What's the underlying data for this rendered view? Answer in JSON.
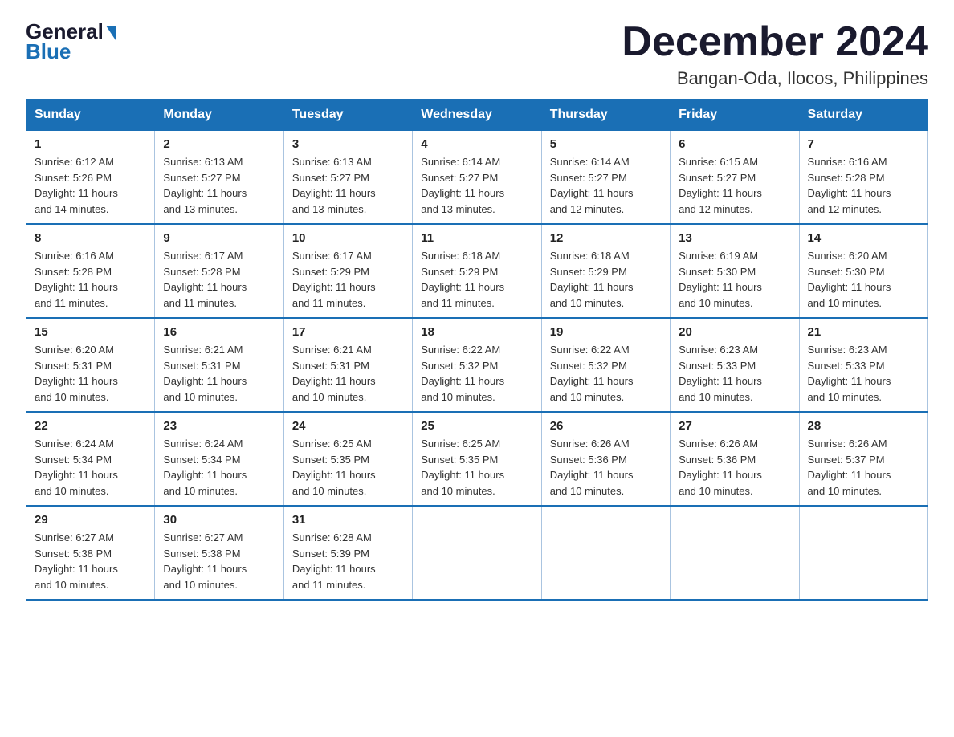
{
  "header": {
    "logo_general": "General",
    "logo_blue": "Blue",
    "month_title": "December 2024",
    "location": "Bangan-Oda, Ilocos, Philippines"
  },
  "days_of_week": [
    "Sunday",
    "Monday",
    "Tuesday",
    "Wednesday",
    "Thursday",
    "Friday",
    "Saturday"
  ],
  "weeks": [
    [
      {
        "day": "1",
        "sunrise": "6:12 AM",
        "sunset": "5:26 PM",
        "daylight": "11 hours and 14 minutes."
      },
      {
        "day": "2",
        "sunrise": "6:13 AM",
        "sunset": "5:27 PM",
        "daylight": "11 hours and 13 minutes."
      },
      {
        "day": "3",
        "sunrise": "6:13 AM",
        "sunset": "5:27 PM",
        "daylight": "11 hours and 13 minutes."
      },
      {
        "day": "4",
        "sunrise": "6:14 AM",
        "sunset": "5:27 PM",
        "daylight": "11 hours and 13 minutes."
      },
      {
        "day": "5",
        "sunrise": "6:14 AM",
        "sunset": "5:27 PM",
        "daylight": "11 hours and 12 minutes."
      },
      {
        "day": "6",
        "sunrise": "6:15 AM",
        "sunset": "5:27 PM",
        "daylight": "11 hours and 12 minutes."
      },
      {
        "day": "7",
        "sunrise": "6:16 AM",
        "sunset": "5:28 PM",
        "daylight": "11 hours and 12 minutes."
      }
    ],
    [
      {
        "day": "8",
        "sunrise": "6:16 AM",
        "sunset": "5:28 PM",
        "daylight": "11 hours and 11 minutes."
      },
      {
        "day": "9",
        "sunrise": "6:17 AM",
        "sunset": "5:28 PM",
        "daylight": "11 hours and 11 minutes."
      },
      {
        "day": "10",
        "sunrise": "6:17 AM",
        "sunset": "5:29 PM",
        "daylight": "11 hours and 11 minutes."
      },
      {
        "day": "11",
        "sunrise": "6:18 AM",
        "sunset": "5:29 PM",
        "daylight": "11 hours and 11 minutes."
      },
      {
        "day": "12",
        "sunrise": "6:18 AM",
        "sunset": "5:29 PM",
        "daylight": "11 hours and 10 minutes."
      },
      {
        "day": "13",
        "sunrise": "6:19 AM",
        "sunset": "5:30 PM",
        "daylight": "11 hours and 10 minutes."
      },
      {
        "day": "14",
        "sunrise": "6:20 AM",
        "sunset": "5:30 PM",
        "daylight": "11 hours and 10 minutes."
      }
    ],
    [
      {
        "day": "15",
        "sunrise": "6:20 AM",
        "sunset": "5:31 PM",
        "daylight": "11 hours and 10 minutes."
      },
      {
        "day": "16",
        "sunrise": "6:21 AM",
        "sunset": "5:31 PM",
        "daylight": "11 hours and 10 minutes."
      },
      {
        "day": "17",
        "sunrise": "6:21 AM",
        "sunset": "5:31 PM",
        "daylight": "11 hours and 10 minutes."
      },
      {
        "day": "18",
        "sunrise": "6:22 AM",
        "sunset": "5:32 PM",
        "daylight": "11 hours and 10 minutes."
      },
      {
        "day": "19",
        "sunrise": "6:22 AM",
        "sunset": "5:32 PM",
        "daylight": "11 hours and 10 minutes."
      },
      {
        "day": "20",
        "sunrise": "6:23 AM",
        "sunset": "5:33 PM",
        "daylight": "11 hours and 10 minutes."
      },
      {
        "day": "21",
        "sunrise": "6:23 AM",
        "sunset": "5:33 PM",
        "daylight": "11 hours and 10 minutes."
      }
    ],
    [
      {
        "day": "22",
        "sunrise": "6:24 AM",
        "sunset": "5:34 PM",
        "daylight": "11 hours and 10 minutes."
      },
      {
        "day": "23",
        "sunrise": "6:24 AM",
        "sunset": "5:34 PM",
        "daylight": "11 hours and 10 minutes."
      },
      {
        "day": "24",
        "sunrise": "6:25 AM",
        "sunset": "5:35 PM",
        "daylight": "11 hours and 10 minutes."
      },
      {
        "day": "25",
        "sunrise": "6:25 AM",
        "sunset": "5:35 PM",
        "daylight": "11 hours and 10 minutes."
      },
      {
        "day": "26",
        "sunrise": "6:26 AM",
        "sunset": "5:36 PM",
        "daylight": "11 hours and 10 minutes."
      },
      {
        "day": "27",
        "sunrise": "6:26 AM",
        "sunset": "5:36 PM",
        "daylight": "11 hours and 10 minutes."
      },
      {
        "day": "28",
        "sunrise": "6:26 AM",
        "sunset": "5:37 PM",
        "daylight": "11 hours and 10 minutes."
      }
    ],
    [
      {
        "day": "29",
        "sunrise": "6:27 AM",
        "sunset": "5:38 PM",
        "daylight": "11 hours and 10 minutes."
      },
      {
        "day": "30",
        "sunrise": "6:27 AM",
        "sunset": "5:38 PM",
        "daylight": "11 hours and 10 minutes."
      },
      {
        "day": "31",
        "sunrise": "6:28 AM",
        "sunset": "5:39 PM",
        "daylight": "11 hours and 11 minutes."
      },
      null,
      null,
      null,
      null
    ]
  ],
  "labels": {
    "sunrise": "Sunrise:",
    "sunset": "Sunset:",
    "daylight": "Daylight:"
  }
}
